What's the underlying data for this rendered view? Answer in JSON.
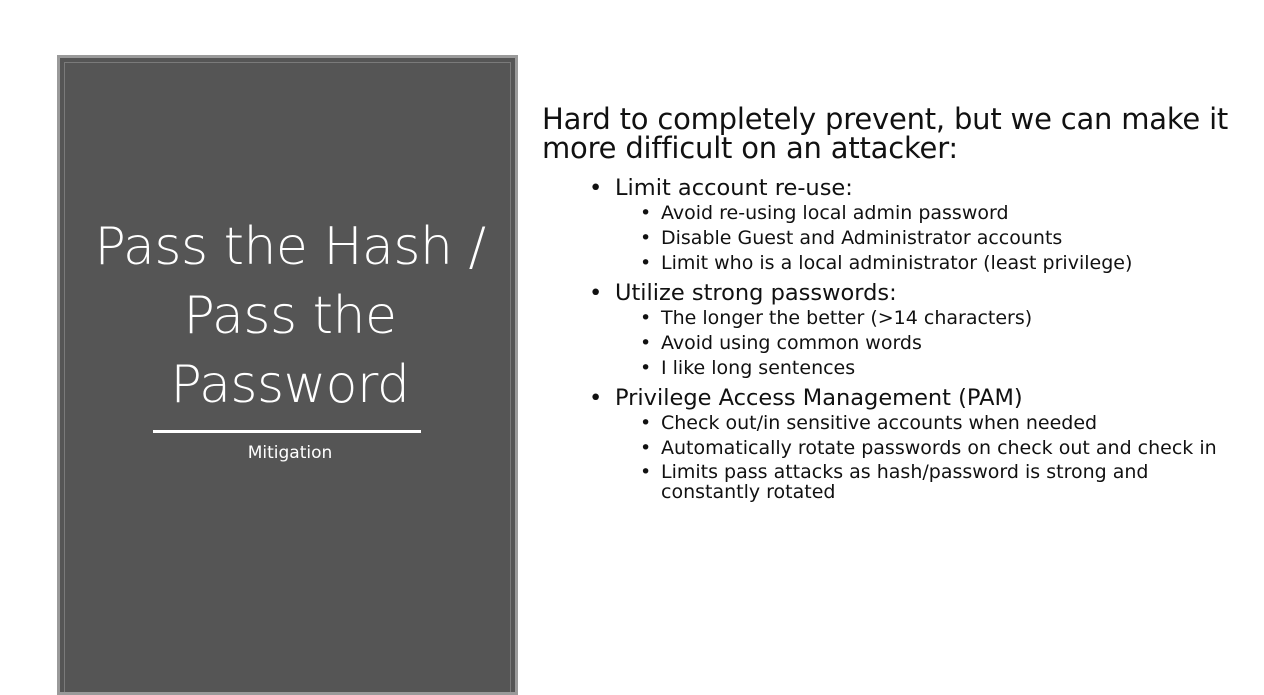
{
  "slide": {
    "title": "Pass the Hash / Pass the Password",
    "subtitle": "Mitigation",
    "lead": "Hard to completely prevent, but we can make it more difficult on an attacker:",
    "sections": [
      {
        "heading": "Limit account re-use:",
        "items": [
          "Avoid re-using local admin password",
          "Disable Guest and Administrator accounts",
          "Limit who is a local administrator (least privilege)"
        ]
      },
      {
        "heading": "Utilize strong passwords:",
        "items": [
          "The longer the better (>14 characters)",
          "Avoid using common words",
          "I like long sentences"
        ]
      },
      {
        "heading": "Privilege Access Management (PAM)",
        "items": [
          "Check out/in sensitive accounts when needed",
          "Automatically rotate passwords on check out and check in",
          "Limits pass attacks as hash/password is strong and constantly rotated"
        ]
      }
    ]
  }
}
